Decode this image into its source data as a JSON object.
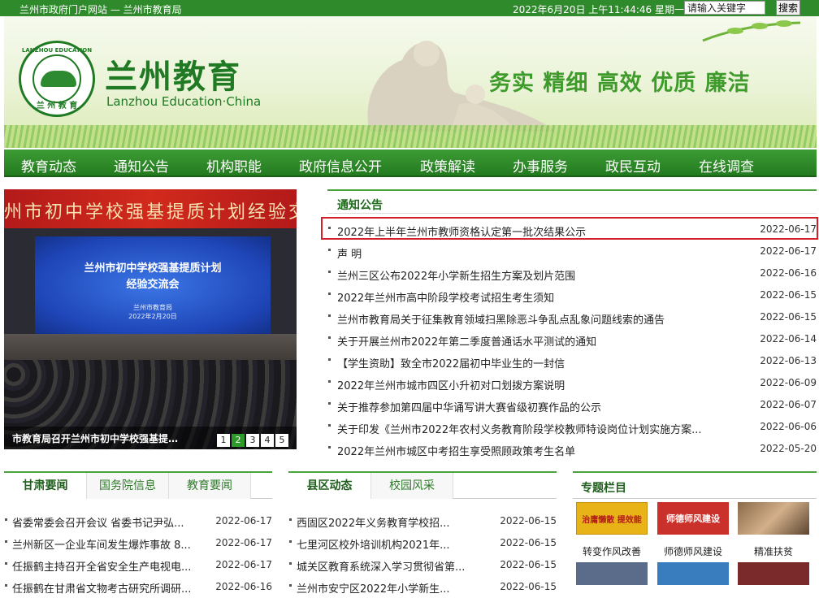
{
  "topbar": {
    "links": "兰州市政府门户网站 — 兰州市教育局",
    "datetime": "2022年6月20日 上午11:44:46 星期一",
    "search_placeholder": "请输入关键字",
    "search_button": "搜索"
  },
  "banner": {
    "logo_ring_text": "LANZHOU EDUCATION",
    "logo_center_text": "兰 州 教 育",
    "title": "兰州教育",
    "subtitle": "Lanzhou Education·China",
    "slogan": "务实 精细 高效 优质 廉洁"
  },
  "nav": [
    "教育动态",
    "通知公告",
    "机构职能",
    "政府信息公开",
    "政策解读",
    "办事服务",
    "政民互动",
    "在线调查"
  ],
  "carousel": {
    "band_text": "州市初中学校强基提质计划经验交流",
    "screen_line1": "兰州市初中学校强基提质计划",
    "screen_line2": "经验交流会",
    "screen_line3": "兰州市教育局",
    "screen_line4": "2022年2月20日",
    "caption": "市教育局召开兰州市初中学校强基提质计划经验交流会",
    "pages": [
      "1",
      "2",
      "3",
      "4",
      "5"
    ],
    "active_page": 1
  },
  "notice": {
    "heading": "通知公告",
    "items": [
      {
        "title": "2022年上半年兰州市教师资格认定第一批次结果公示",
        "date": "2022-06-17"
      },
      {
        "title": "声 明",
        "date": "2022-06-17"
      },
      {
        "title": "兰州三区公布2022年小学新生招生方案及划片范围",
        "date": "2022-06-16"
      },
      {
        "title": "2022年兰州市高中阶段学校考试招生考生须知",
        "date": "2022-06-15"
      },
      {
        "title": "兰州市教育局关于征集教育领域扫黑除恶斗争乱点乱象问题线索的通告",
        "date": "2022-06-15"
      },
      {
        "title": "关于开展兰州市2022年第二季度普通话水平测试的通知",
        "date": "2022-06-14"
      },
      {
        "title": "【学生资助】致全市2022届初中毕业生的一封信",
        "date": "2022-06-13"
      },
      {
        "title": "2022年兰州市城市四区小升初对口划拨方案说明",
        "date": "2022-06-09"
      },
      {
        "title": "关于推荐参加第四届中华诵写讲大赛省级初赛作品的公示",
        "date": "2022-06-07"
      },
      {
        "title": "关于印发《兰州市2022年农村义务教育阶段学校教师特设岗位计划实施方案...",
        "date": "2022-06-06"
      },
      {
        "title": "2022年兰州市城区中考招生享受照顾政策考生名单",
        "date": "2022-05-20"
      }
    ]
  },
  "panel_left": {
    "tabs": [
      "甘肃要闻",
      "国务院信息",
      "教育要闻"
    ],
    "items": [
      {
        "title": "省委常委会召开会议 省委书记尹弘...",
        "date": "2022-06-17"
      },
      {
        "title": "兰州新区一企业车间发生爆炸事故 8...",
        "date": "2022-06-17"
      },
      {
        "title": "任振鹤主持召开全省安全生产电视电...",
        "date": "2022-06-17"
      },
      {
        "title": "任振鹤在甘肃省文物考古研究所调研...",
        "date": "2022-06-16"
      }
    ]
  },
  "panel_mid": {
    "tabs": [
      "县区动态",
      "校园风采"
    ],
    "items": [
      {
        "title": "西固区2022年义务教育学校招...",
        "date": "2022-06-15"
      },
      {
        "title": "七里河区校外培训机构2021年...",
        "date": "2022-06-15"
      },
      {
        "title": "城关区教育系统深入学习贯彻省第...",
        "date": "2022-06-15"
      },
      {
        "title": "兰州市安宁区2022年小学新生...",
        "date": "2022-06-15"
      }
    ]
  },
  "special": {
    "heading": "专题栏目",
    "items": [
      {
        "label": "转变作风改善",
        "img_text": "治庸懒散 提效能",
        "color": "#e8b317"
      },
      {
        "label": "师德师风建设",
        "img_text": "师德师风建设",
        "color": "#c9312a"
      },
      {
        "label": "精准扶贫",
        "img_text": "",
        "color": "#8a6a4a"
      }
    ]
  }
}
